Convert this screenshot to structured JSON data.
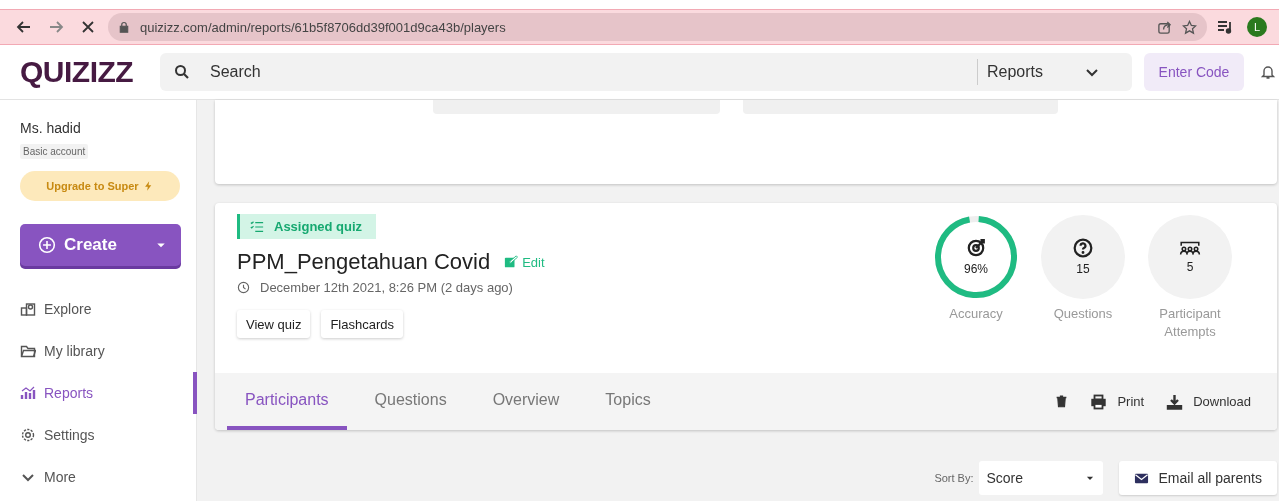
{
  "browser": {
    "url": "quizizz.com/admin/reports/61b5f8706dd39f001d9ca43b/players",
    "avatar": "L"
  },
  "header": {
    "logo": "QUIZIZZ",
    "search": {
      "placeholder": "Search"
    },
    "scope": "Reports",
    "enter_code": "Enter Code"
  },
  "sidebar": {
    "user": "Ms. hadid",
    "account": "Basic account",
    "upgrade": "Upgrade to Super",
    "create": "Create",
    "items": [
      {
        "kind": "explore",
        "label": "Explore",
        "selected": false
      },
      {
        "kind": "library",
        "label": "My library",
        "selected": false
      },
      {
        "kind": "reports",
        "label": "Reports",
        "selected": true
      },
      {
        "kind": "settings",
        "label": "Settings",
        "selected": false
      },
      {
        "kind": "more",
        "label": "More",
        "selected": false
      }
    ]
  },
  "quiz": {
    "tag": "Assigned quiz",
    "title": "PPM_Pengetahuan Covid",
    "edit": "Edit",
    "date": "December 12th 2021, 8:26 PM (2 days ago)",
    "buttons": [
      "View quiz",
      "Flashcards"
    ],
    "stats": [
      {
        "kind": "accuracy",
        "value": "96%",
        "label": "Accuracy",
        "level": 0.96
      },
      {
        "kind": "questions",
        "value": "15",
        "label": "Questions"
      },
      {
        "kind": "participants",
        "value": "5",
        "label": "Participant Attempts"
      }
    ],
    "tabs": [
      {
        "label": "Participants",
        "selected": true
      },
      {
        "label": "Questions",
        "selected": false
      },
      {
        "label": "Overview",
        "selected": false
      },
      {
        "label": "Topics",
        "selected": false
      }
    ],
    "actions": [
      {
        "kind": "delete"
      },
      {
        "kind": "print",
        "label": "Print"
      },
      {
        "kind": "download",
        "label": "Download"
      }
    ]
  },
  "sort": {
    "label": "Sort By:",
    "value": "Score"
  },
  "email_button": "Email all parents"
}
